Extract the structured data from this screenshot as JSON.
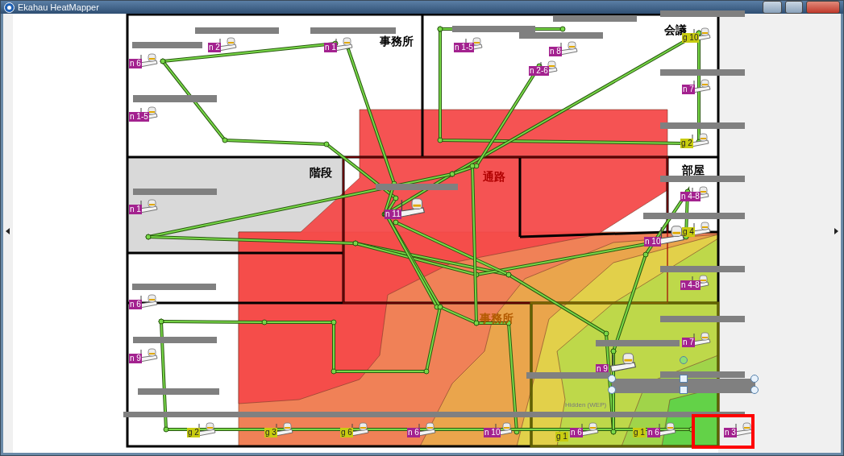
{
  "window": {
    "title": "Ekahau HeatMapper"
  },
  "rooms": [
    {
      "label": "事務所"
    },
    {
      "label": "会議"
    },
    {
      "label": "階段"
    },
    {
      "label": "通路"
    },
    {
      "label": "部屋"
    },
    {
      "label": "事務所"
    }
  ],
  "access_points": [
    {
      "label": "n 6",
      "kind": "n"
    },
    {
      "label": "n 2",
      "kind": "n"
    },
    {
      "label": "n 1",
      "kind": "n"
    },
    {
      "label": "n 1-5",
      "kind": "n"
    },
    {
      "label": "n 1-5",
      "kind": "n"
    },
    {
      "label": "n 8",
      "kind": "n"
    },
    {
      "label": "n 2-6",
      "kind": "n"
    },
    {
      "label": "g 10",
      "kind": "g"
    },
    {
      "label": "n 7",
      "kind": "n"
    },
    {
      "label": "g 2",
      "kind": "g"
    },
    {
      "label": "n 1",
      "kind": "n"
    },
    {
      "label": "n 11",
      "kind": "n"
    },
    {
      "label": "n 4-8",
      "kind": "n"
    },
    {
      "label": "g 4",
      "kind": "g"
    },
    {
      "label": "n 10",
      "kind": "n"
    },
    {
      "label": "n 4-8",
      "kind": "n"
    },
    {
      "label": "n 6",
      "kind": "n"
    },
    {
      "label": "n 9",
      "kind": "n"
    },
    {
      "label": "n 7",
      "kind": "n"
    },
    {
      "label": "n 9",
      "kind": "n"
    },
    {
      "label": "g 2",
      "kind": "g"
    },
    {
      "label": "g 3",
      "kind": "g"
    },
    {
      "label": "g 6",
      "kind": "g"
    },
    {
      "label": "n 6",
      "kind": "n"
    },
    {
      "label": "n 10",
      "kind": "n"
    },
    {
      "label": "g 1",
      "kind": "g"
    },
    {
      "label": "n 6",
      "kind": "n"
    },
    {
      "label": "g 1",
      "kind": "g"
    },
    {
      "label": "n 6",
      "kind": "n"
    },
    {
      "label": "n 3",
      "kind": "n"
    }
  ],
  "hidden_network_label": "Hidden (WEP)"
}
